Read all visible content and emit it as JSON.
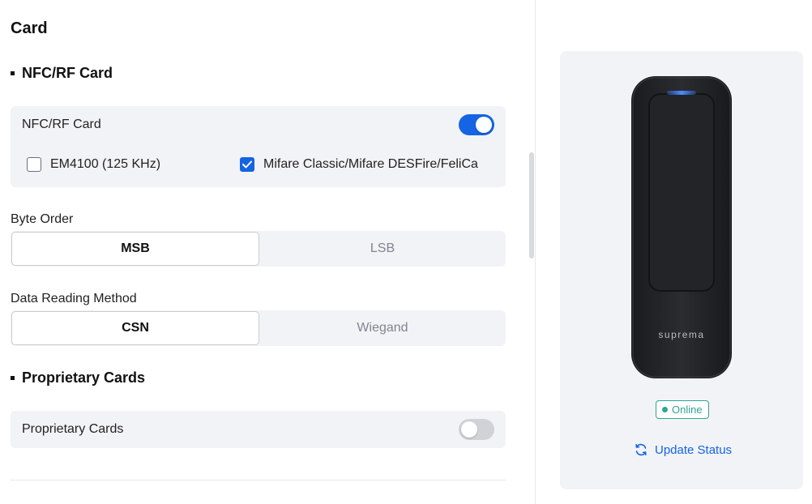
{
  "page": {
    "title": "Card"
  },
  "nfc_section": {
    "heading": "NFC/RF Card",
    "panel_label": "NFC/RF Card",
    "toggle_on": true,
    "options": [
      {
        "label": "EM4100 (125 KHz)",
        "checked": false
      },
      {
        "label": "Mifare Classic/Mifare DESFire/FeliCa",
        "checked": true
      }
    ]
  },
  "byte_order": {
    "label": "Byte Order",
    "options": [
      "MSB",
      "LSB"
    ],
    "selected": "MSB"
  },
  "data_reading": {
    "label": "Data Reading Method",
    "options": [
      "CSN",
      "Wiegand"
    ],
    "selected": "CSN"
  },
  "proprietary_section": {
    "heading": "Proprietary Cards",
    "panel_label": "Proprietary Cards",
    "toggle_on": false
  },
  "device": {
    "brand": "suprema",
    "status": "Online",
    "update_label": "Update Status",
    "icons": {
      "update": "refresh-icon",
      "status": "status-dot-icon"
    }
  },
  "colors": {
    "accent": "#1464e4",
    "online": "#2fa493",
    "panel_bg": "#f2f3f6"
  }
}
